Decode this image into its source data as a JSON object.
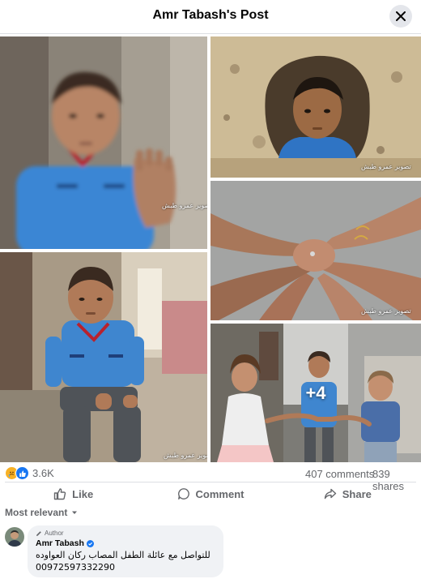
{
  "header": {
    "title": "Amr Tabash's Post",
    "close_icon": "close-icon"
  },
  "photos": {
    "watermark": "تصوير عمرو طبش",
    "more_count": "+4"
  },
  "stats": {
    "reaction_icons": [
      "care-reaction-icon",
      "like-reaction-icon"
    ],
    "reactions": "3.6K",
    "comments": "407 comments",
    "shares": "839 shares"
  },
  "actions": {
    "like": "Like",
    "comment": "Comment",
    "share": "Share"
  },
  "sort": {
    "label": "Most relevant"
  },
  "comment": {
    "badge": "Author",
    "name": "Amr Tabash",
    "line1": "للتواصل مع عائلة الطفل المصاب ركان العواوده",
    "line2": "00972597332290"
  },
  "colors": {
    "accent": "#1877f2",
    "secondary_text": "#65676b",
    "bubble": "#f0f2f5"
  }
}
